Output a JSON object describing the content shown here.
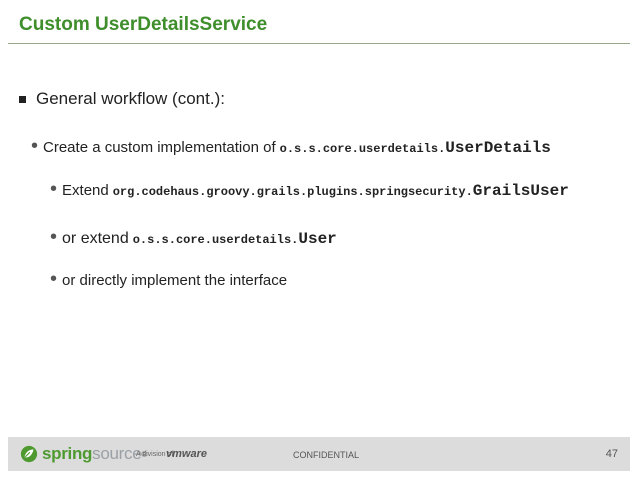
{
  "slide": {
    "title": "Custom UserDetailsService",
    "bullet1": "General workflow (cont.):",
    "bullet2": {
      "text": "Create a custom implementation of",
      "pkg": "o.s.s.core.userdetails.",
      "cls": "UserDetails"
    },
    "sub1": {
      "text": "Extend",
      "pkg": "org.codehaus.groovy.grails.plugins.springsecurity.",
      "cls": "GrailsUser"
    },
    "sub2": {
      "text": "or extend",
      "pkg": "o.s.s.core.userdetails.",
      "cls": "User"
    },
    "sub3": {
      "text": "or directly implement the interface"
    }
  },
  "footer": {
    "brand_spring": "spring",
    "brand_source": "source",
    "division": "A division of",
    "vmware": "vmware",
    "confidential": "CONFIDENTIAL",
    "page": "47"
  },
  "colors": {
    "title": "#3f8e2c",
    "footer_bg": "#dcdcdc",
    "brand_green": "#4e9a31"
  }
}
